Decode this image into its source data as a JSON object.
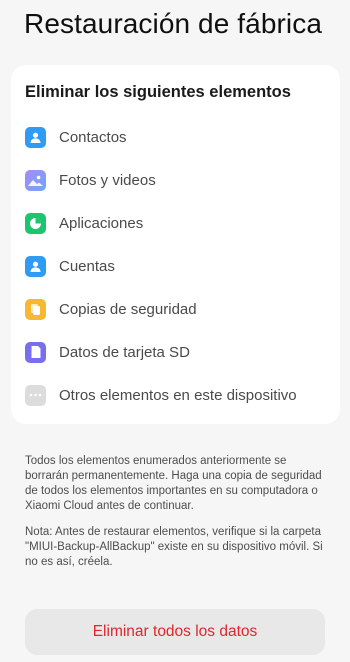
{
  "page": {
    "title": "Restauración de fábrica"
  },
  "card": {
    "title": "Eliminar los siguientes elementos",
    "items": [
      {
        "label": "Contactos",
        "icon": "contacts-icon",
        "color": "#2f9bf2"
      },
      {
        "label": "Fotos y videos",
        "icon": "gallery-icon",
        "color": "#8f7ff0"
      },
      {
        "label": "Aplicaciones",
        "icon": "apps-icon",
        "color": "#1ec46e"
      },
      {
        "label": "Cuentas",
        "icon": "accounts-icon",
        "color": "#2f9bf2"
      },
      {
        "label": "Copias de seguridad",
        "icon": "backup-icon",
        "color": "#f6b833"
      },
      {
        "label": "Datos de tarjeta SD",
        "icon": "sd-card-icon",
        "color": "#7a6ef0"
      },
      {
        "label": "Otros elementos en este dispositivo",
        "icon": "more-icon",
        "color": "#dcdcdc"
      }
    ]
  },
  "notice": {
    "main": "Todos los elementos enumerados anteriormente se borrarán permanentemente. Haga una copia de seguridad de todos los elementos importantes en su computadora o Xiaomi Cloud antes de continuar.",
    "note": "Nota: Antes de restaurar elementos, verifique si la carpeta \"MIUI-Backup-AllBackup\" existe en su dispositivo móvil. Si no es así, créela."
  },
  "action": {
    "label": "Eliminar todos los datos",
    "color": "#e0262e"
  }
}
